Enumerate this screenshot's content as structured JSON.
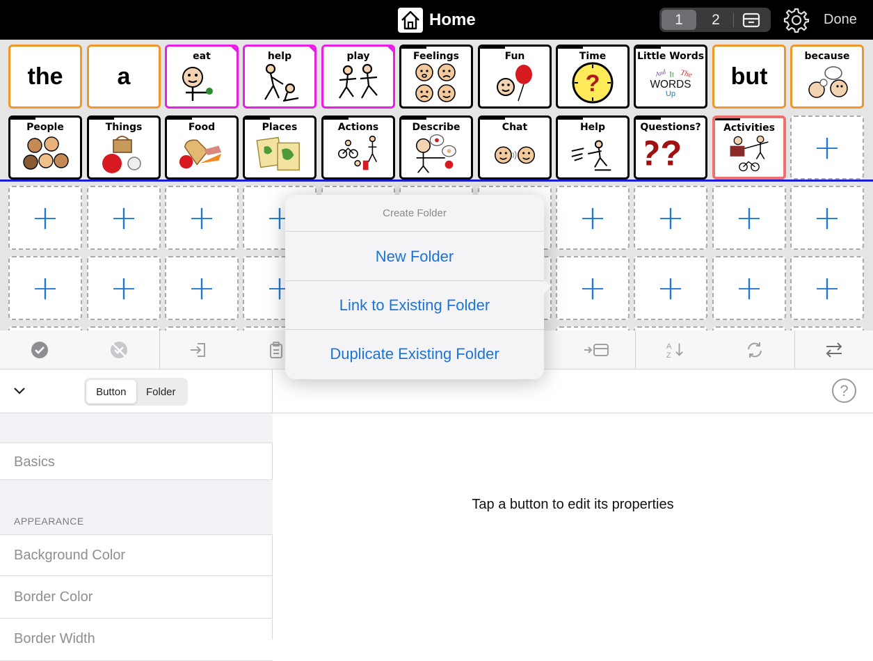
{
  "header": {
    "title": "Home",
    "pages": [
      "1",
      "2"
    ],
    "done_label": "Done"
  },
  "grid": {
    "row1": [
      {
        "kind": "word",
        "label": "the"
      },
      {
        "kind": "word",
        "label": "a"
      },
      {
        "kind": "action",
        "label": "eat"
      },
      {
        "kind": "action",
        "label": "help"
      },
      {
        "kind": "action",
        "label": "play"
      },
      {
        "kind": "folder",
        "label": "Feelings"
      },
      {
        "kind": "folder",
        "label": "Fun"
      },
      {
        "kind": "folder",
        "label": "Time"
      },
      {
        "kind": "folder",
        "label": "Little Words"
      },
      {
        "kind": "word",
        "label": "but"
      },
      {
        "kind": "word",
        "label": "because"
      }
    ],
    "row2": [
      {
        "kind": "folder",
        "label": "People"
      },
      {
        "kind": "folder",
        "label": "Things"
      },
      {
        "kind": "folder",
        "label": "Food"
      },
      {
        "kind": "folder",
        "label": "Places"
      },
      {
        "kind": "folder",
        "label": "Actions"
      },
      {
        "kind": "folder",
        "label": "Describe"
      },
      {
        "kind": "folder",
        "label": "Chat"
      },
      {
        "kind": "folder",
        "label": "Help"
      },
      {
        "kind": "folder",
        "label": "Questions?"
      },
      {
        "kind": "folder",
        "label": "Activities"
      }
    ],
    "little_words_art": [
      "And",
      "It",
      "The",
      "WORDS",
      "Up"
    ],
    "questions_art": "??",
    "time_art": "?",
    "add_symbol": "+"
  },
  "popover": {
    "title": "Create Folder",
    "items": [
      "New Folder",
      "Link to Existing Folder",
      "Duplicate Existing Folder"
    ]
  },
  "inspector": {
    "segments": [
      "Button",
      "Folder"
    ],
    "help_label": "?",
    "basics_label": "Basics",
    "appearance_header": "APPEARANCE",
    "rows": [
      "Background Color",
      "Border Color",
      "Border Width"
    ],
    "empty_message": "Tap a button to edit its properties"
  },
  "colors": {
    "word_border": "#f0962a",
    "action_border": "#e81ee6",
    "folder_border": "#000000",
    "selected_border": "#f07070",
    "add_blue": "#1c78d9",
    "divider_blue": "#1c1cd6"
  }
}
